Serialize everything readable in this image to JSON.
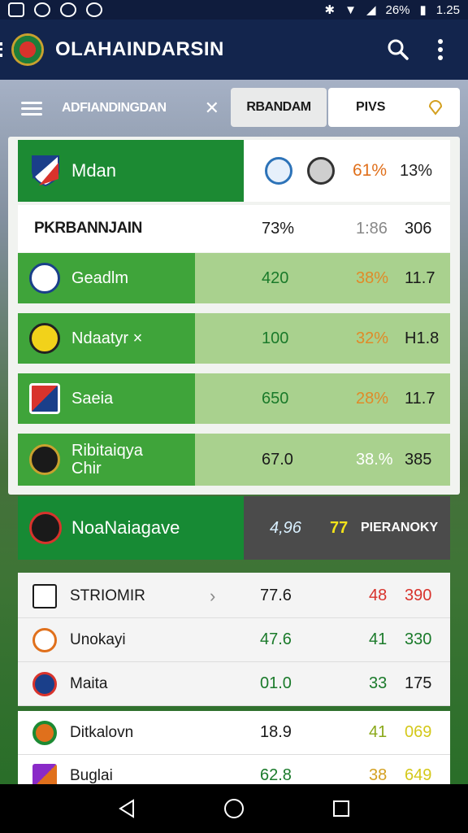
{
  "status_bar": {
    "battery_text": "26%",
    "time": "1.25"
  },
  "app_bar": {
    "title": "OLAHAINDARSIN"
  },
  "filter": {
    "label": "ADFIANDINGDAN",
    "close": "✕",
    "pill1": "RBANDAM",
    "pill2": "PIVS"
  },
  "hero": {
    "team": "Mdan",
    "pct": "61%",
    "value": "13%"
  },
  "subheader": {
    "title": "PKRBANNJAIN",
    "v1": "73%",
    "v2": "1:86",
    "v3": "306"
  },
  "green_rows": [
    {
      "name": "Geadlm",
      "v1": "420",
      "v2": "38%",
      "v3": "11.7"
    },
    {
      "name": "Ndaatyr ×",
      "v1": "100",
      "v2": "32%",
      "v3": "H1.8"
    },
    {
      "name": "Saeia",
      "v1": "650",
      "v2": "28%",
      "v3": "11.7"
    },
    {
      "name": "Ribitaiqya Chir",
      "v1": "67.0",
      "v2": "38.%",
      "v3": "385"
    }
  ],
  "featured": {
    "name": "NoaNaiagave",
    "v1": "4,96",
    "v2": "77",
    "v3": "PIERANOKY"
  },
  "list_rows": [
    {
      "name": "STRIOMIR",
      "v1": "77.6",
      "v2": "48",
      "v3": "390"
    },
    {
      "name": "Unokayi",
      "v1": "47.6",
      "v2": "41",
      "v3": "330"
    },
    {
      "name": "Maita",
      "v1": "01.0",
      "v2": "33",
      "v3": "175"
    }
  ],
  "bottom_rows": [
    {
      "name": "Ditkalovn",
      "v1": "18.9",
      "v2": "41",
      "v3": "069"
    },
    {
      "name": "Buglai",
      "v1": "62.8",
      "v2": "38",
      "v3": "649"
    }
  ],
  "colors": {
    "primary_green": "#1c8a33",
    "light_green": "#a9d18e",
    "header_navy": "#13254d",
    "accent_orange": "#e0701c"
  }
}
